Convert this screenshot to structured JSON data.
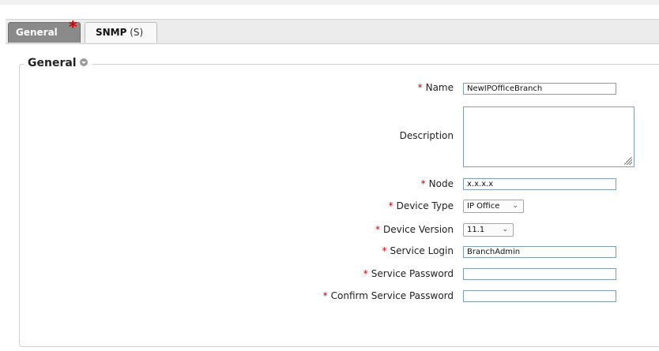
{
  "tabs": {
    "general": {
      "label": "General",
      "required_marker": "*"
    },
    "snmp": {
      "label": "SNMP",
      "suffix": "(S)"
    }
  },
  "section": {
    "title": "General"
  },
  "form": {
    "required_marker": "*",
    "name": {
      "label": "Name",
      "value": "NewIPOfficeBranch"
    },
    "description": {
      "label": "Description",
      "value": ""
    },
    "node": {
      "label": "Node",
      "value": "x.x.x.x"
    },
    "device_type": {
      "label": "Device Type",
      "value": "IP Office"
    },
    "device_version": {
      "label": "Device Version",
      "value": "11.1"
    },
    "service_login": {
      "label": "Service Login",
      "value": "BranchAdmin"
    },
    "service_password": {
      "label": "Service Password",
      "value": ""
    },
    "confirm_service_password": {
      "label": "Confirm Service Password",
      "value": ""
    }
  },
  "icons": {
    "collapse": "chevron-down-icon",
    "resize": "resize-grip-icon",
    "select_arrow": "chevron-down-icon"
  },
  "colors": {
    "required": "#d00000",
    "active_tab": "#8a8a8a",
    "input_border": "#7e9db9"
  }
}
